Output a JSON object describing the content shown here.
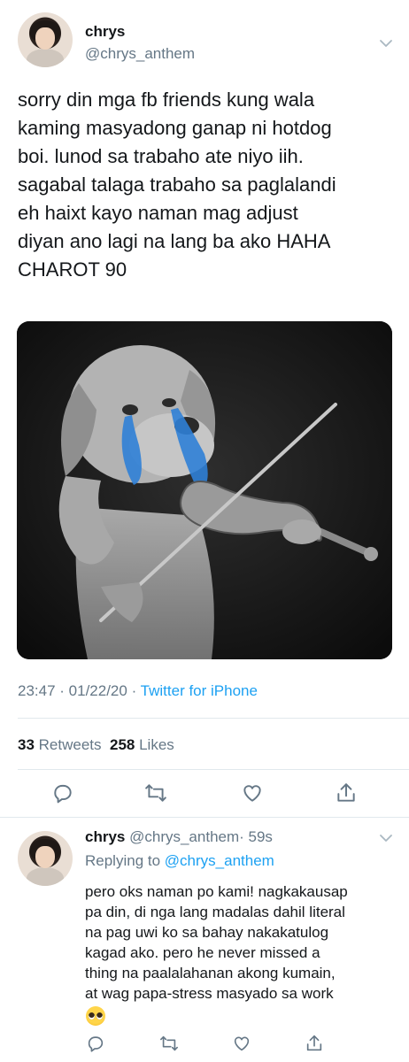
{
  "tweet": {
    "author_name": "chrys",
    "author_handle": "@chrys_anthem",
    "text": "sorry din mga fb friends kung wala\nkaming masyadong ganap ni hotdog\nboi. lunod sa trabaho ate niyo iih.\nsagabal talaga trabaho sa paglalandi\neh haixt kayo naman mag adjust\ndiyan ano lagi na lang ba ako HAHA\nCHAROT 90",
    "time": "23:47",
    "date": "01/22/20",
    "separator": "·",
    "source": "Twitter for iPhone",
    "retweets_count": "33",
    "retweets_label": "Retweets",
    "likes_count": "258",
    "likes_label": "Likes",
    "media_icon": "crying-dog-violin-meme-image"
  },
  "reply": {
    "author_name": "chrys",
    "author_handle": "@chrys_anthem",
    "age": "· 59s",
    "replying_prefix": "Replying to",
    "replying_to": "@chrys_anthem",
    "text": "pero oks naman po kami! nagkakausap\npa din, di nga lang madalas dahil literal\nna pag uwi ko sa bahay nakakatulog\nkagad ako. pero he never missed a\nthing na paalalahanan akong kumain,\nat wag papa-stress masyado sa work",
    "emoji_icon": "pleading-face-emoji"
  },
  "icons": {
    "reply": "reply-icon",
    "retweet": "retweet-icon",
    "like": "heart-icon",
    "share": "share-icon",
    "more": "chevron-down-icon"
  },
  "colors": {
    "link": "#1da1f2",
    "secondary_text": "#657786",
    "primary_text": "#14171a",
    "divider": "#e1e8ed"
  }
}
